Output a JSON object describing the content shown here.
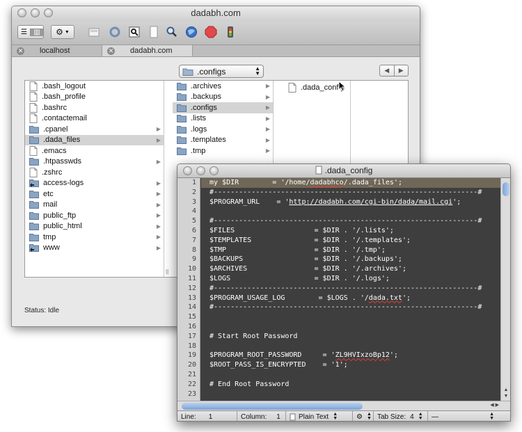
{
  "browser_window": {
    "title": "dadabh.com",
    "tabs": [
      {
        "label": "localhost",
        "active": false
      },
      {
        "label": "dadabh.com",
        "active": true
      }
    ],
    "path_popup": ".configs",
    "status": "Status: Idle",
    "column1": [
      {
        "name": ".bash_logout",
        "type": "file"
      },
      {
        "name": ".bash_profile",
        "type": "file"
      },
      {
        "name": ".bashrc",
        "type": "file"
      },
      {
        "name": ".contactemail",
        "type": "file"
      },
      {
        "name": ".cpanel",
        "type": "folder"
      },
      {
        "name": ".dada_files",
        "type": "folder",
        "selected": true
      },
      {
        "name": ".emacs",
        "type": "file"
      },
      {
        "name": ".htpasswds",
        "type": "folder"
      },
      {
        "name": ".zshrc",
        "type": "file"
      },
      {
        "name": "access-logs",
        "type": "folder-link"
      },
      {
        "name": "etc",
        "type": "folder"
      },
      {
        "name": "mail",
        "type": "folder"
      },
      {
        "name": "public_ftp",
        "type": "folder"
      },
      {
        "name": "public_html",
        "type": "folder"
      },
      {
        "name": "tmp",
        "type": "folder"
      },
      {
        "name": "www",
        "type": "folder-link"
      }
    ],
    "column2": [
      {
        "name": ".archives",
        "type": "folder"
      },
      {
        "name": ".backups",
        "type": "folder"
      },
      {
        "name": ".configs",
        "type": "folder",
        "selected": true
      },
      {
        "name": ".lists",
        "type": "folder"
      },
      {
        "name": ".logs",
        "type": "folder"
      },
      {
        "name": ".templates",
        "type": "folder"
      },
      {
        "name": ".tmp",
        "type": "folder"
      }
    ],
    "column3": [
      {
        "name": ".dada_config",
        "type": "file"
      }
    ]
  },
  "editor_window": {
    "title": ".dada_config",
    "lines": [
      {
        "n": "1",
        "text": "my $DIR        = '/home/dadabhco/.dada_files';"
      },
      {
        "n": "2",
        "text": "#---------------------------------------------------------------#"
      },
      {
        "n": "3",
        "text": "$PROGRAM_URL    = 'http://dadabh.com/cgi-bin/dada/mail.cgi';"
      },
      {
        "n": "4",
        "text": ""
      },
      {
        "n": "5",
        "text": "#---------------------------------------------------------------#"
      },
      {
        "n": "6",
        "text": "$FILES                   = $DIR . '/.lists';"
      },
      {
        "n": "7",
        "text": "$TEMPLATES               = $DIR . '/.templates';"
      },
      {
        "n": "8",
        "text": "$TMP                     = $DIR . '/.tmp';"
      },
      {
        "n": "9",
        "text": "$BACKUPS                 = $DIR . '/.backups';"
      },
      {
        "n": "10",
        "text": "$ARCHIVES                = $DIR . '/.archives';"
      },
      {
        "n": "11",
        "text": "$LOGS                    = $DIR . '/.logs';"
      },
      {
        "n": "12",
        "text": "#---------------------------------------------------------------#"
      },
      {
        "n": "13",
        "text": "$PROGRAM_USAGE_LOG        = $LOGS . '/dada.txt';"
      },
      {
        "n": "14",
        "text": "#---------------------------------------------------------------#"
      },
      {
        "n": "15",
        "text": ""
      },
      {
        "n": "16",
        "text": ""
      },
      {
        "n": "17",
        "text": "# Start Root Password"
      },
      {
        "n": "18",
        "text": ""
      },
      {
        "n": "19",
        "text": "$PROGRAM_ROOT_PASSWORD     = 'ZL9HVIxzoBp12';"
      },
      {
        "n": "20",
        "text": "$ROOT_PASS_IS_ENCRYPTED    = '1';"
      },
      {
        "n": "21",
        "text": ""
      },
      {
        "n": "22",
        "text": "# End Root Password"
      },
      {
        "n": "23",
        "text": ""
      }
    ],
    "status": {
      "line_label": "Line:",
      "line_value": "1",
      "column_label": "Column:",
      "column_value": "1",
      "syntax": "Plain Text",
      "tab_size_label": "Tab Size:",
      "tab_size_value": "4",
      "symbol": "—"
    }
  }
}
